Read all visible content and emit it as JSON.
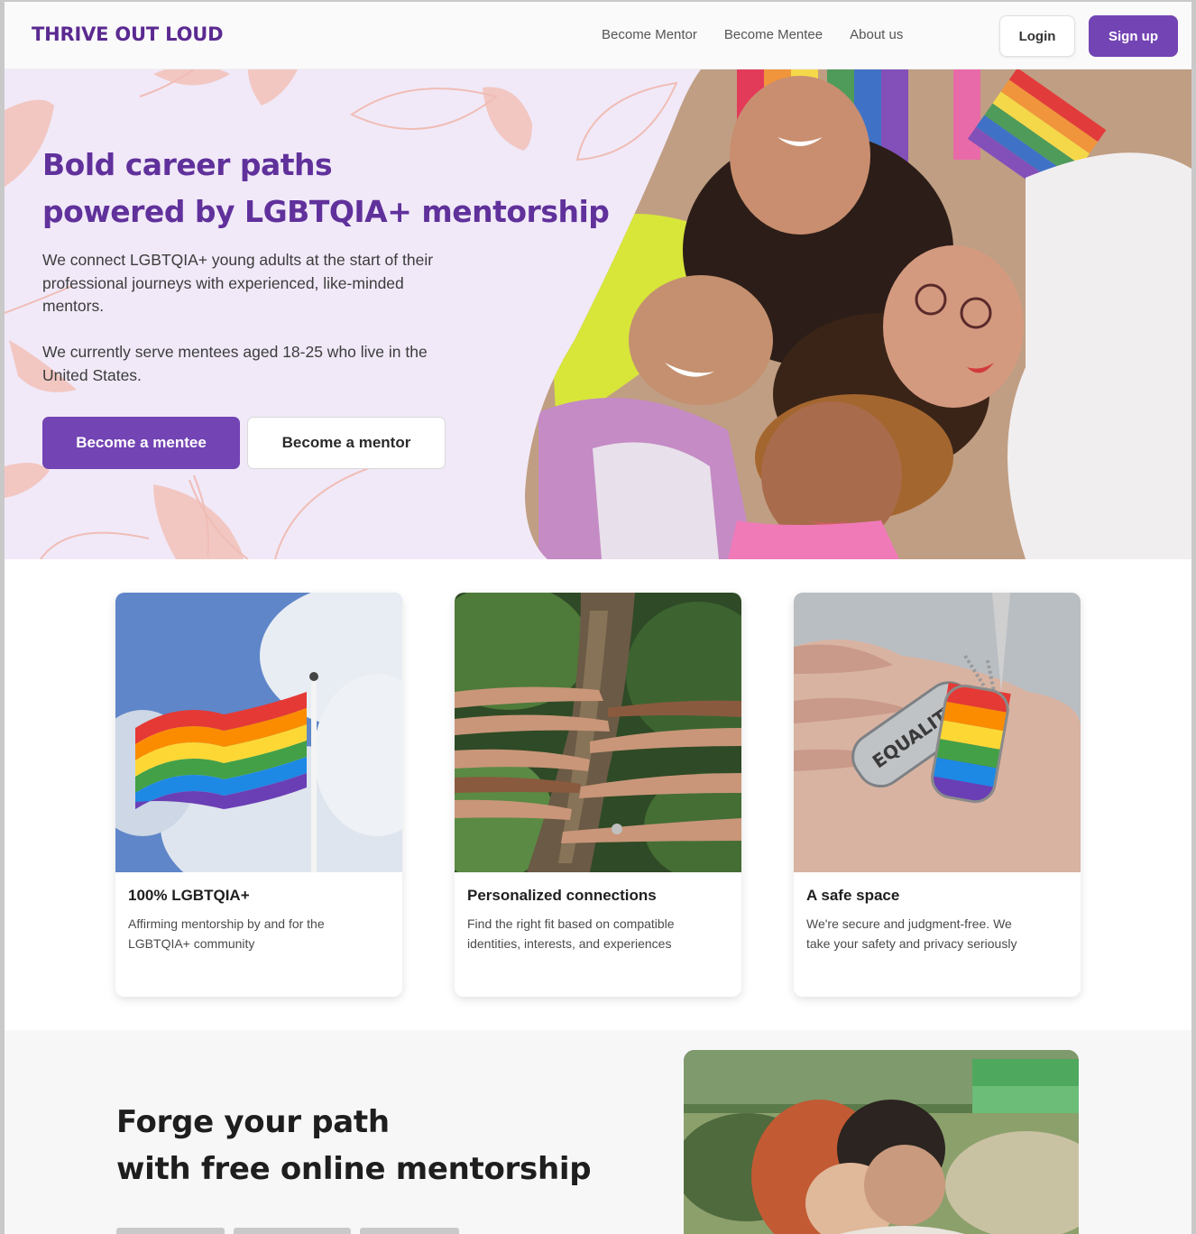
{
  "header": {
    "logo": "THRIVE OUT LOUD",
    "nav": [
      {
        "label": "Become Mentor"
      },
      {
        "label": "Become Mentee"
      },
      {
        "label": "About us"
      }
    ],
    "login_label": "Login",
    "signup_label": "Sign up"
  },
  "hero": {
    "title_line1": "Bold career paths",
    "title_line2": "powered by LGBTQIA+ mentorship",
    "paragraph1": "We connect LGBTQIA+ young adults at the start of their professional journeys with experienced, like-minded mentors.",
    "paragraph2": "We currently serve mentees aged 18-25 who live in the United States.",
    "primary_button": "Become a mentee",
    "secondary_button": "Become a mentor",
    "photo_icon": "group-portrait-photo"
  },
  "features": [
    {
      "title": "100% LGBTQIA+",
      "text": "Affirming mentorship by and for the LGBTQIA+ community",
      "image_icon": "rainbow-flag-photo"
    },
    {
      "title": "Personalized connections",
      "text": "Find the right fit based on compatible identities, interests, and experiences",
      "image_icon": "hands-on-tree-photo"
    },
    {
      "title": "A safe space",
      "text": "We're secure and judgment-free. We take your safety and privacy seriously",
      "image_icon": "equality-dog-tags-photo",
      "image_text": "EQUALITY"
    }
  ],
  "mentorship": {
    "title_line1": "Forge your path",
    "title_line2": "with free online mentorship",
    "photo_icon": "two-people-photo"
  },
  "colors": {
    "brand": "#7344b4",
    "brand_dark": "#5b2a91",
    "hero_bg": "#f1e9f8",
    "leaf": "#f0c4c0"
  }
}
